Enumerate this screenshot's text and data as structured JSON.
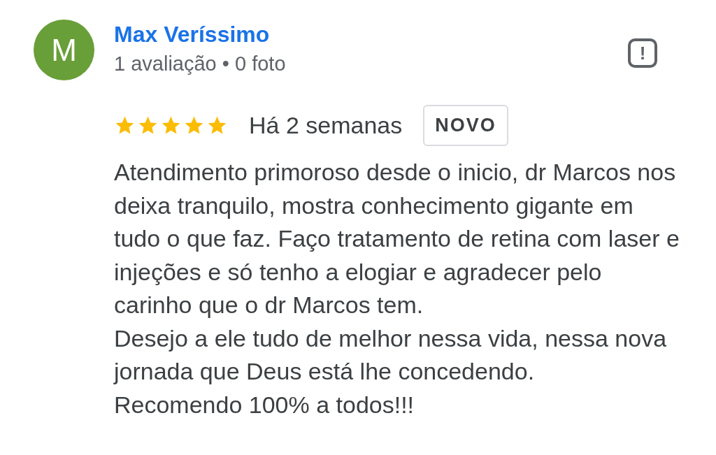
{
  "review": {
    "avatar_letter": "M",
    "author": "Max Veríssimo",
    "meta": "1 avaliação • 0 foto",
    "flag_icon_text": "!",
    "stars": 5,
    "time": "Há 2 semanas",
    "badge": "NOVO",
    "paragraphs": [
      "Atendimento primoroso desde o inicio, dr Marcos nos deixa tranquilo, mostra conhecimento gigante em tudo o que faz. Faço tratamento de retina com laser e injeções e só tenho a elogiar e agradecer pelo carinho que o dr Marcos tem.",
      "Desejo a ele tudo de melhor nessa vida, nessa nova jornada que Deus está lhe concedendo.",
      "Recomendo 100% a todos!!!"
    ]
  }
}
